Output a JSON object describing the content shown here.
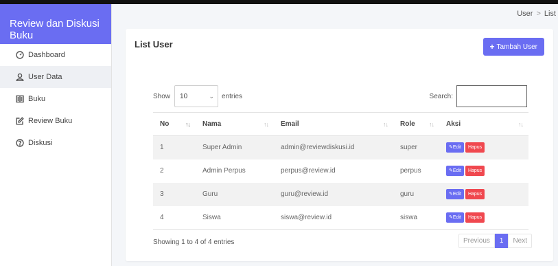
{
  "app": {
    "brand": "Review dan Diskusi Buku"
  },
  "sidebar": {
    "items": [
      {
        "label": "Dashboard",
        "icon": "gauge-icon",
        "active": false
      },
      {
        "label": "User Data",
        "icon": "user-icon",
        "active": true
      },
      {
        "label": "Buku",
        "icon": "book-icon",
        "active": false
      },
      {
        "label": "Review Buku",
        "icon": "edit-icon",
        "active": false
      },
      {
        "label": "Diskusi",
        "icon": "help-circle-icon",
        "active": false
      }
    ]
  },
  "breadcrumb": {
    "items": [
      "User",
      "List"
    ],
    "separator": ">"
  },
  "card": {
    "title": "List User",
    "add_button": "Tambah User",
    "length": {
      "prefix": "Show",
      "value": "10",
      "suffix": "entries"
    },
    "search": {
      "label": "Search:",
      "value": ""
    },
    "table": {
      "headers": [
        "No",
        "Nama",
        "Email",
        "Role",
        "Aksi"
      ],
      "rows": [
        {
          "no": "1",
          "nama": "Super Admin",
          "email": "admin@reviewdiskusi.id",
          "role": "super"
        },
        {
          "no": "2",
          "nama": "Admin Perpus",
          "email": "perpus@review.id",
          "role": "perpus"
        },
        {
          "no": "3",
          "nama": "Guru",
          "email": "guru@review.id",
          "role": "guru"
        },
        {
          "no": "4",
          "nama": "Siswa",
          "email": "siswa@review.id",
          "role": "siswa"
        }
      ],
      "edit_label": "Edit",
      "delete_label": "Hapus"
    },
    "info": "Showing 1 to 4 of 4 entries",
    "pagination": {
      "previous": "Previous",
      "current": "1",
      "next": "Next"
    }
  },
  "colors": {
    "accent": "#6a6df2",
    "danger": "#f0484f",
    "sidebar_bg": "#ffffff",
    "page_bg": "#f4f6f9"
  }
}
